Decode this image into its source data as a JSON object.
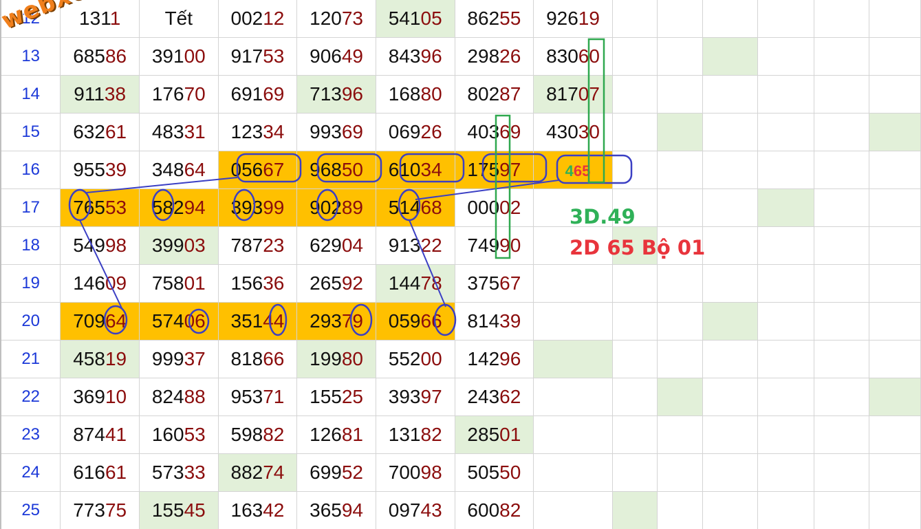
{
  "watermark": "webxoso.net",
  "rows": [
    {
      "num": "12",
      "cells": [
        {
          "p": "131",
          "s": "1"
        },
        {
          "p": "Tết",
          "s": ""
        },
        {
          "p": "002",
          "s": "12"
        },
        {
          "p": "120",
          "s": "73"
        },
        {
          "p": "541",
          "s": "05"
        },
        {
          "p": "862",
          "s": "55"
        },
        {
          "p": "926",
          "s": "19"
        }
      ]
    },
    {
      "num": "13",
      "cells": [
        {
          "p": "685",
          "s": "86"
        },
        {
          "p": "391",
          "s": "00"
        },
        {
          "p": "917",
          "s": "53"
        },
        {
          "p": "906",
          "s": "49"
        },
        {
          "p": "843",
          "s": "96"
        },
        {
          "p": "298",
          "s": "26"
        },
        {
          "p": "830",
          "s": "60"
        }
      ]
    },
    {
      "num": "14",
      "cells": [
        {
          "p": "911",
          "s": "38"
        },
        {
          "p": "176",
          "s": "70"
        },
        {
          "p": "691",
          "s": "69"
        },
        {
          "p": "713",
          "s": "96"
        },
        {
          "p": "168",
          "s": "80"
        },
        {
          "p": "802",
          "s": "87"
        },
        {
          "p": "817",
          "s": "07"
        }
      ]
    },
    {
      "num": "15",
      "cells": [
        {
          "p": "632",
          "s": "61"
        },
        {
          "p": "483",
          "s": "31"
        },
        {
          "p": "123",
          "s": "34"
        },
        {
          "p": "993",
          "s": "69"
        },
        {
          "p": "069",
          "s": "26"
        },
        {
          "p": "403",
          "s": "69"
        },
        {
          "p": "430",
          "s": "30"
        }
      ]
    },
    {
      "num": "16",
      "cells": [
        {
          "p": "955",
          "s": "39"
        },
        {
          "p": "348",
          "s": "64"
        },
        {
          "p": "056",
          "s": "67"
        },
        {
          "p": "968",
          "s": "50"
        },
        {
          "p": "610",
          "s": "34"
        },
        {
          "p": "175",
          "s": "97"
        },
        {
          "p": "4",
          "s": "65"
        }
      ]
    },
    {
      "num": "17",
      "cells": [
        {
          "p": "765",
          "s": "53"
        },
        {
          "p": "582",
          "s": "94"
        },
        {
          "p": "393",
          "s": "99"
        },
        {
          "p": "902",
          "s": "89"
        },
        {
          "p": "514",
          "s": "68"
        },
        {
          "p": "000",
          "s": "02"
        },
        {
          "p": "",
          "s": ""
        }
      ]
    },
    {
      "num": "18",
      "cells": [
        {
          "p": "549",
          "s": "98"
        },
        {
          "p": "399",
          "s": "03"
        },
        {
          "p": "787",
          "s": "23"
        },
        {
          "p": "629",
          "s": "04"
        },
        {
          "p": "913",
          "s": "22"
        },
        {
          "p": "749",
          "s": "90"
        },
        {
          "p": "",
          "s": ""
        }
      ]
    },
    {
      "num": "19",
      "cells": [
        {
          "p": "146",
          "s": "09"
        },
        {
          "p": "758",
          "s": "01"
        },
        {
          "p": "156",
          "s": "36"
        },
        {
          "p": "265",
          "s": "92"
        },
        {
          "p": "144",
          "s": "78"
        },
        {
          "p": "375",
          "s": "67"
        },
        {
          "p": "",
          "s": ""
        }
      ]
    },
    {
      "num": "20",
      "cells": [
        {
          "p": "709",
          "s": "64"
        },
        {
          "p": "574",
          "s": "06"
        },
        {
          "p": "351",
          "s": "44"
        },
        {
          "p": "293",
          "s": "79"
        },
        {
          "p": "059",
          "s": "66"
        },
        {
          "p": "814",
          "s": "39"
        },
        {
          "p": "",
          "s": ""
        }
      ]
    },
    {
      "num": "21",
      "cells": [
        {
          "p": "458",
          "s": "19"
        },
        {
          "p": "999",
          "s": "37"
        },
        {
          "p": "818",
          "s": "66"
        },
        {
          "p": "199",
          "s": "80"
        },
        {
          "p": "552",
          "s": "00"
        },
        {
          "p": "142",
          "s": "96"
        },
        {
          "p": "",
          "s": ""
        }
      ]
    },
    {
      "num": "22",
      "cells": [
        {
          "p": "369",
          "s": "10"
        },
        {
          "p": "824",
          "s": "88"
        },
        {
          "p": "953",
          "s": "71"
        },
        {
          "p": "155",
          "s": "25"
        },
        {
          "p": "393",
          "s": "97"
        },
        {
          "p": "243",
          "s": "62"
        },
        {
          "p": "",
          "s": ""
        }
      ]
    },
    {
      "num": "23",
      "cells": [
        {
          "p": "874",
          "s": "41"
        },
        {
          "p": "160",
          "s": "53"
        },
        {
          "p": "598",
          "s": "82"
        },
        {
          "p": "126",
          "s": "81"
        },
        {
          "p": "131",
          "s": "82"
        },
        {
          "p": "285",
          "s": "01"
        },
        {
          "p": "",
          "s": ""
        }
      ]
    },
    {
      "num": "24",
      "cells": [
        {
          "p": "616",
          "s": "61"
        },
        {
          "p": "573",
          "s": "33"
        },
        {
          "p": "882",
          "s": "74"
        },
        {
          "p": "699",
          "s": "52"
        },
        {
          "p": "700",
          "s": "98"
        },
        {
          "p": "505",
          "s": "50"
        },
        {
          "p": "",
          "s": ""
        }
      ]
    },
    {
      "num": "25",
      "cells": [
        {
          "p": "773",
          "s": "75"
        },
        {
          "p": "155",
          "s": "45"
        },
        {
          "p": "163",
          "s": "42"
        },
        {
          "p": "365",
          "s": "94"
        },
        {
          "p": "097",
          "s": "43"
        },
        {
          "p": "600",
          "s": "82"
        },
        {
          "p": "",
          "s": ""
        }
      ]
    }
  ],
  "annotations": {
    "line1": "3D.49",
    "line2": "2D 65 Bộ 01"
  },
  "colors": {
    "orange_fill": "#ffc000",
    "green_fill": "#e2f0d9",
    "row_number": "#1c39d8",
    "tail_digits": "#8b0d0d",
    "circle_stroke": "#3b3fc4",
    "box_stroke": "#2fa84f",
    "note_green": "#2fb158",
    "note_red": "#e8343c"
  }
}
